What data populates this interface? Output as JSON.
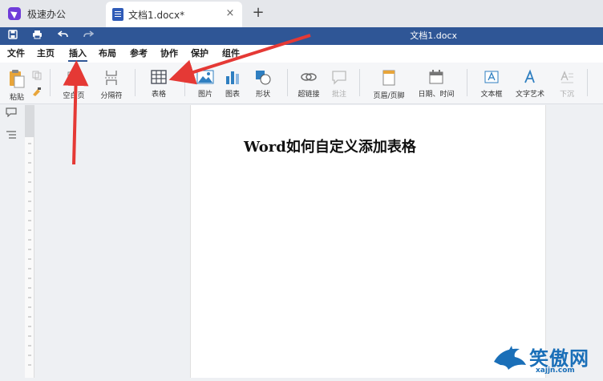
{
  "tabs": {
    "app_tab_label": "极速办公",
    "doc_tab_label": "文档1.docx*",
    "close_symbol": "×",
    "new_tab_symbol": "+"
  },
  "titlebar": {
    "title": "文档1.docx"
  },
  "menu": {
    "items": [
      "文件",
      "主页",
      "插入",
      "布局",
      "参考",
      "协作",
      "保护",
      "组件"
    ],
    "active": "插入"
  },
  "ribbon": {
    "paste": "粘贴",
    "page_break": "空白页",
    "section_break": "分隔符",
    "table": "表格",
    "image": "图片",
    "chart": "图表",
    "shape": "形状",
    "hyperlink": "超链接",
    "comment": "批注",
    "header_footer": "页眉/页脚",
    "datetime": "日期、时间",
    "textbox": "文本框",
    "textart": "文字艺术",
    "dropcap": "下沉"
  },
  "document": {
    "heading": "Word如何自定义添加表格"
  },
  "watermark": {
    "brand": "笑傲网",
    "url": "xajjn.com"
  },
  "colors": {
    "accent": "#2f5696",
    "arrow": "#e53935",
    "table_icon": "#4a4f5a"
  },
  "icons": [
    "app-logo-icon",
    "document-icon",
    "save-icon",
    "print-icon",
    "undo-icon",
    "redo-icon",
    "paste-icon",
    "format-painter-icon",
    "table-icon",
    "image-icon",
    "chart-icon",
    "shape-icon",
    "hyperlink-icon",
    "comment-icon",
    "header-footer-icon",
    "calendar-icon",
    "textbox-icon",
    "textart-icon",
    "dropcap-icon",
    "comment-side-icon",
    "navigation-icon"
  ]
}
